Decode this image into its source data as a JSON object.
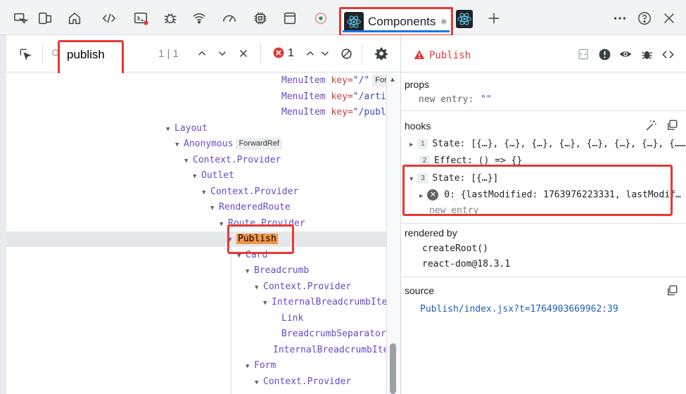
{
  "tabs": {
    "components_label": "Components",
    "components_suffix": "⚛"
  },
  "search": {
    "value": "publish",
    "match_count": "1 | 1"
  },
  "errors": {
    "count": "1"
  },
  "tree": {
    "rows": [
      {
        "text": "MenuItem",
        "key": "key=",
        "val": "\"/\"",
        "badge": "For"
      },
      {
        "text": "MenuItem",
        "key": "key=",
        "val": "\"/artic"
      },
      {
        "text": "MenuItem",
        "key": "key=",
        "val": "\"/publi"
      },
      {
        "text": "Layout"
      },
      {
        "text": "Anonymous",
        "badge": "ForwardRef"
      },
      {
        "text": "Context.Provider"
      },
      {
        "text": "Outlet"
      },
      {
        "text": "Context.Provider"
      },
      {
        "text": "RenderedRoute"
      },
      {
        "text": "Route.Provider"
      },
      {
        "text": "Publish"
      },
      {
        "text": "Card"
      },
      {
        "text": "Breadcrumb"
      },
      {
        "text": "Context.Provider"
      },
      {
        "text": "InternalBreadcrumbIter"
      },
      {
        "text": "Link"
      },
      {
        "text": "BreadcrumbSeparator"
      },
      {
        "text": "InternalBreadcrumbIter"
      },
      {
        "text": "Form"
      },
      {
        "text": "Context.Provider"
      }
    ]
  },
  "inspector": {
    "component_name": "Publish",
    "props_title": "props",
    "props_entry_label": "new entry:",
    "props_entry_value": "\"\"",
    "hooks_title": "hooks",
    "hook1_num": "1",
    "hook1_text": "State: [{…}, {…}, {…}, {…}, {…}, {…}, {…}, {……",
    "hook2_num": "2",
    "hook2_text": "Effect: () => {}",
    "hook3_num": "3",
    "hook3_text": "State: [{…}]",
    "hook3_item": "0: {lastModified: 1763976223331, lastModif…",
    "hook3_new_entry": "new entry",
    "rendered_by_title": "rendered by",
    "rendered_by_1": "createRoot()",
    "rendered_by_2": "react-dom@18.3.1",
    "source_title": "source",
    "source_value": "Publish/index.jsx?t=1764903669962:39"
  },
  "colors": {
    "accent_red": "#e53935",
    "component_purple": "#6a48c9",
    "highlight_orange": "#f3964a",
    "link_blue": "#1a73e8"
  }
}
